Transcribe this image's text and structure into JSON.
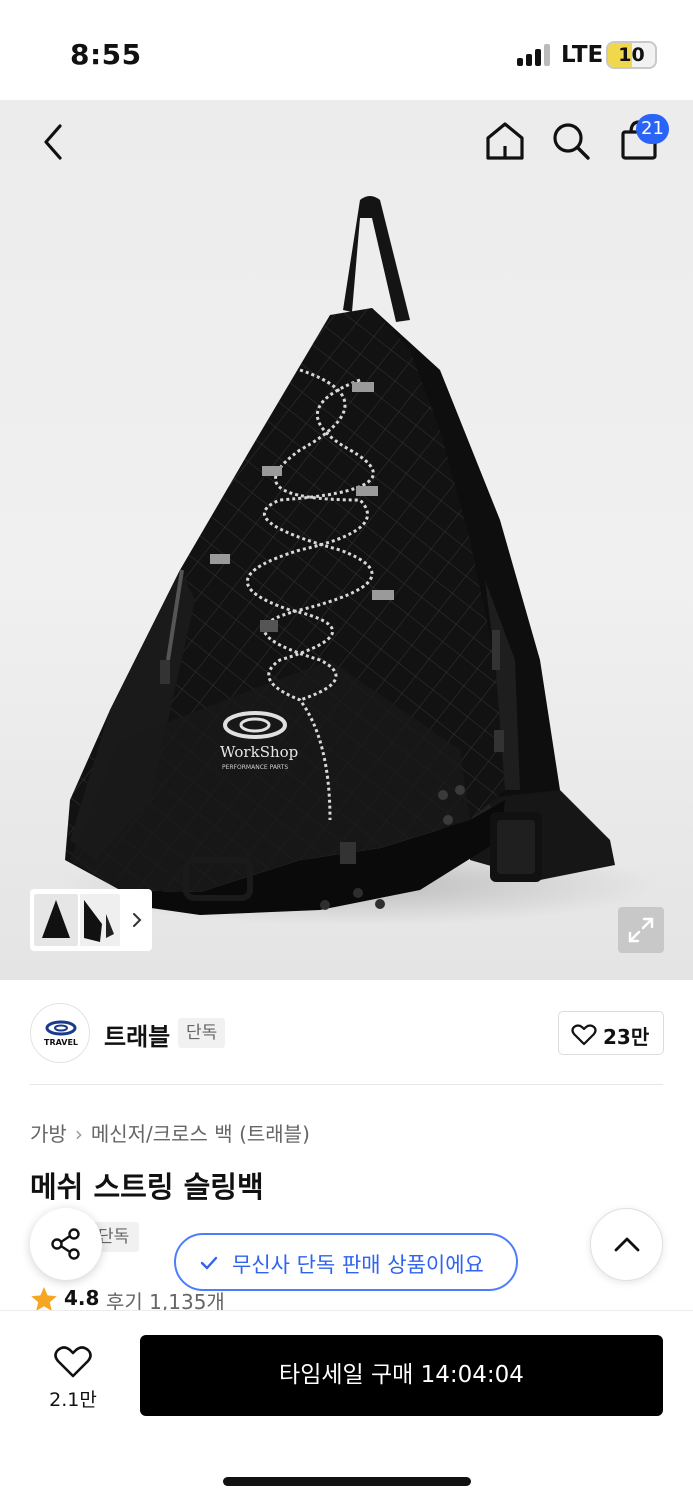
{
  "status_bar": {
    "time": "8:55",
    "network": "LTE",
    "battery": "10",
    "battery_color": "#f0d84c"
  },
  "top_nav": {
    "back_icon": "chevron-left-icon",
    "home_icon": "home-icon",
    "search_icon": "search-icon",
    "cart_icon": "shopping-bag-icon",
    "cart_count": "21",
    "badge_color": "#2a64f6"
  },
  "hero": {
    "image": "black mesh string sling backpack product photo",
    "logo_text": "WorkShop",
    "logo_subtext": "PERFORMANCE PARTS",
    "expand_icon": "expand-icon",
    "thumbnail_next_icon": "chevron-right-icon"
  },
  "brand": {
    "name": "트래블",
    "logo_text": "TRAVEL",
    "tag": "단독",
    "like_count": "23만"
  },
  "product": {
    "breadcrumb": [
      "가방",
      "메신저/크로스 백 (트래블)"
    ],
    "title": "메쉬 스트링 슬링백",
    "tag": "단독",
    "rating": "4.8",
    "reviews": "후기 1,135개"
  },
  "toast": {
    "message": "무신사 단독 판매 상품이에요",
    "accent": "#2f63f0"
  },
  "bottom_bar": {
    "wish_count": "2.1만",
    "buy_label": "타임세일 구매 14:04:04"
  }
}
